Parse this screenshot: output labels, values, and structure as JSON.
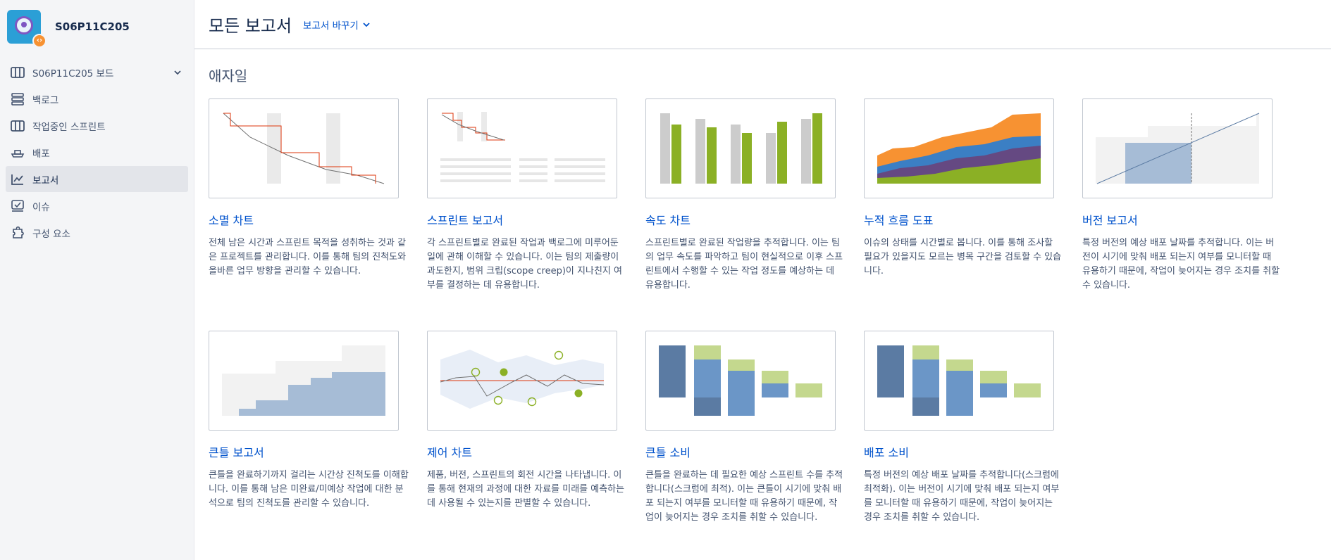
{
  "project": {
    "name": "S06P11C205",
    "avatar_icon": "project-avatar-icon",
    "badge_icon": "code-badge-icon"
  },
  "sidebar": {
    "items": [
      {
        "label": "S06P11C205 보드",
        "icon": "board-icon",
        "active": false
      },
      {
        "label": "백로그",
        "icon": "backlog-icon",
        "active": false
      },
      {
        "label": "작업중인 스프린트",
        "icon": "sprint-board-icon",
        "active": false
      },
      {
        "label": "배포",
        "icon": "ship-icon",
        "active": false
      },
      {
        "label": "보고서",
        "icon": "reports-icon",
        "active": true
      },
      {
        "label": "이슈",
        "icon": "issues-icon",
        "active": false
      },
      {
        "label": "구성 요소",
        "icon": "components-icon",
        "active": false
      }
    ]
  },
  "header": {
    "title": "모든 보고서",
    "switch_label": "보고서 바꾸기"
  },
  "section": {
    "title": "애자일"
  },
  "reports": [
    {
      "title": "소멸 차트",
      "desc": "전체 남은 시간과 스프린트 목적을 성취하는 것과 같은 프로젝트를 관리합니다. 이를 통해 팀의 진척도와 올바른 업무 방향을 관리할 수 있습니다."
    },
    {
      "title": "스프린트 보고서",
      "desc": "각 스프린트별로 완료된 작업과 백로그에 미루어둔 일에 관해 이해할 수 있습니다. 이는 팀의 제출량이 과도한지, 범위 크립(scope creep)이 지나친지 여부를 결정하는 데 유용합니다."
    },
    {
      "title": "속도 차트",
      "desc": "스프린트별로 완료된 작업량을 추적합니다. 이는 팀의 업무 속도를 파악하고 팀이 현실적으로 이후 스프린트에서 수행할 수 있는 작업 정도를 예상하는 데 유용합니다."
    },
    {
      "title": "누적 흐름 도표",
      "desc": "이슈의 상태를 시간별로 봅니다. 이를 통해 조사할 필요가 있을지도 모르는 병목 구간을 검토할 수 있습니다."
    },
    {
      "title": "버전 보고서",
      "desc": "특정 버전의 예상 배포 날짜를 추적합니다. 이는 버전이 시기에 맞춰 배포 되는지 여부를 모니터할 때 유용하기 때문에, 작업이 늦어지는 경우 조치를 취할 수 있습니다."
    },
    {
      "title": "큰틀 보고서",
      "desc": "큰틀을 완료하기까지 걸리는 시간상 진척도를 이해합니다. 이를 통해 남은 미완료/미예상 작업에 대한 분석으로 팀의 진척도를 관리할 수 있습니다."
    },
    {
      "title": "제어 차트",
      "desc": "제품, 버전, 스프린트의 회전 시간을 나타냅니다. 이를 통해 현재의 과정에 대한 자료를 미래를 예측하는데 사용될 수 있는지를 판별할 수 있습니다."
    },
    {
      "title": "큰틀 소비",
      "desc": "큰틀을 완료하는 데 필요한 예상 스프린트 수를 추적합니다(스크럼에 최적). 이는 큰틀이 시기에 맞춰 배포 되는지 여부를 모니터할 때 유용하기 때문에, 작업이 늦어지는 경우 조치를 취할 수 있습니다."
    },
    {
      "title": "배포 소비",
      "desc": "특정 버전의 예상 배포 날짜를 추적합니다(스크럼에 최적화). 이는 버전이 시기에 맞춰 배포 되는지 여부를 모니터할 때 유용하기 때문에, 작업이 늦어지는 경우 조치를 취할 수 있습니다."
    }
  ],
  "colors": {
    "link": "#0052cc",
    "red": "#de350b",
    "grey": "#cccccc",
    "green": "#8bb025",
    "orange": "#f79232",
    "blue": "#3b7fc4",
    "purple": "#654982",
    "navy": "#5b7ba3",
    "light_blue": "#6b96c7",
    "light_green": "#c4d88e",
    "version_blue": "#a6bcd6"
  }
}
